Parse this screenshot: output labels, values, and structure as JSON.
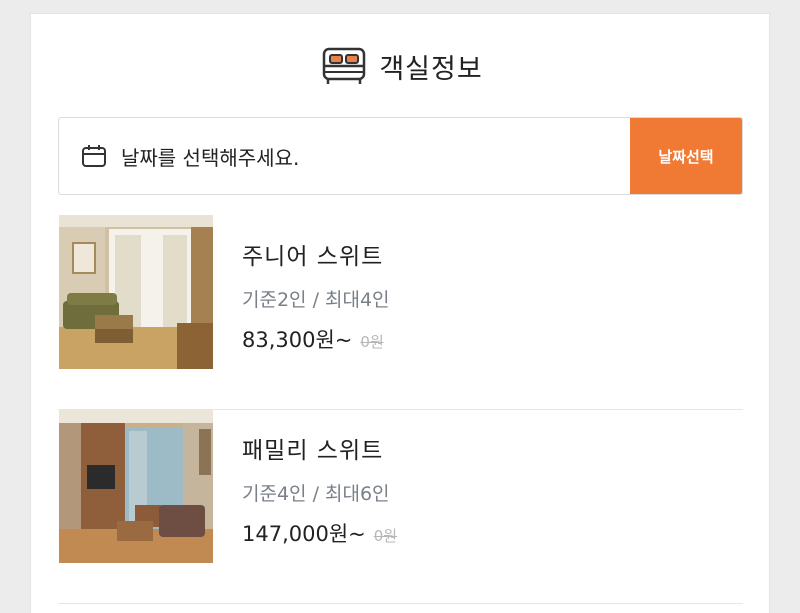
{
  "section": {
    "title": "객실정보",
    "title_icon": "bed-icon"
  },
  "date_selector": {
    "icon": "calendar-icon",
    "placeholder": "날짜를 선택해주세요.",
    "button_label": "날짜선택"
  },
  "rooms": [
    {
      "name": "주니어 스위트",
      "capacity": "기준2인 / 최대4인",
      "price": "83,300원~",
      "original_price": "0원"
    },
    {
      "name": "패밀리 스위트",
      "capacity": "기준4인 / 최대6인",
      "price": "147,000원~",
      "original_price": "0원"
    }
  ],
  "colors": {
    "accent": "#f07a34",
    "muted": "#7a8088"
  }
}
